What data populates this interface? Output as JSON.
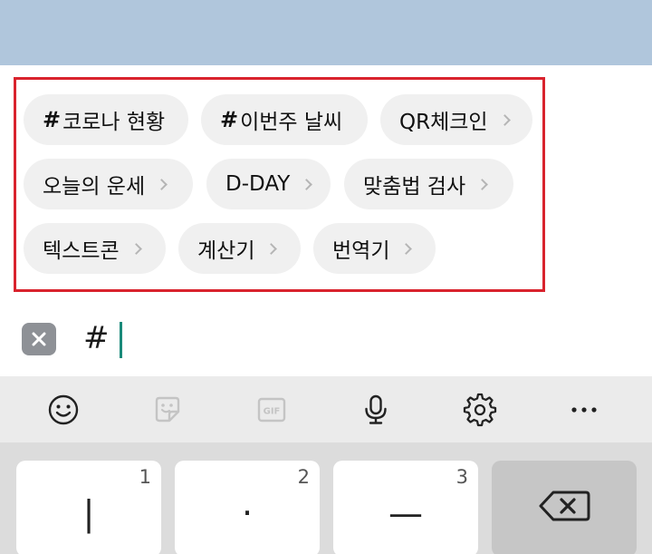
{
  "chips": [
    {
      "hash": "#",
      "label": "코로나 현황",
      "chevron": false
    },
    {
      "hash": "#",
      "label": "이번주 날씨",
      "chevron": false
    },
    {
      "hash": "",
      "label": "QR체크인",
      "chevron": true
    },
    {
      "hash": "",
      "label": "오늘의 운세",
      "chevron": true
    },
    {
      "hash": "",
      "label": "D-DAY",
      "chevron": true
    },
    {
      "hash": "",
      "label": "맞춤법 검사",
      "chevron": true
    },
    {
      "hash": "",
      "label": "텍스트콘",
      "chevron": true
    },
    {
      "hash": "",
      "label": "계산기",
      "chevron": true
    },
    {
      "hash": "",
      "label": "번역기",
      "chevron": true
    }
  ],
  "input": {
    "value": "#"
  },
  "toolbar": {
    "items": [
      "emoji-icon",
      "sticker-icon",
      "gif-icon",
      "microphone-icon",
      "settings-icon",
      "more-icon"
    ],
    "gif_label": "GIF"
  },
  "keyboard": {
    "keys": [
      {
        "number": "1",
        "glyph": "|"
      },
      {
        "number": "2",
        "glyph": "·"
      },
      {
        "number": "3",
        "glyph": "—"
      }
    ],
    "backspace_icon": "backspace-icon"
  },
  "colors": {
    "highlight": "#d9232d",
    "top_band": "#b0c6dc",
    "caret": "#1a8a7a"
  }
}
